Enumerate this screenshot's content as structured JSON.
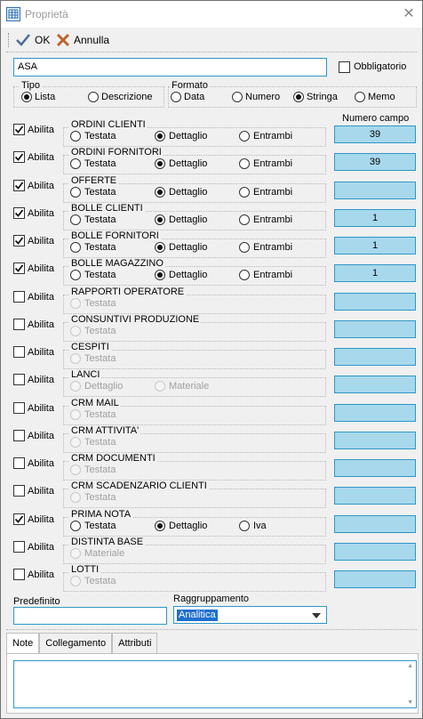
{
  "window": {
    "title": "Proprietà",
    "close_symbol": "✕"
  },
  "toolbar": {
    "ok_label": "OK",
    "cancel_label": "Annulla"
  },
  "name_field": {
    "value": "ASA"
  },
  "obbligatorio": {
    "label": "Obbligatorio",
    "checked": false
  },
  "tipo": {
    "title": "Tipo",
    "options": [
      "Lista",
      "Descrizione"
    ],
    "selected": "Lista"
  },
  "formato": {
    "title": "Formato",
    "options": [
      "Data",
      "Numero",
      "Stringa",
      "Memo"
    ],
    "selected": "Stringa"
  },
  "numero_campo_header": "Numero campo",
  "rows": [
    {
      "abilita": "Abilita",
      "checked": true,
      "title": "ORDINI CLIENTI",
      "options": [
        "Testata",
        "Dettaglio",
        "Entrambi"
      ],
      "selected": "Dettaglio",
      "enabled": true,
      "numero": "39"
    },
    {
      "abilita": "Abilita",
      "checked": true,
      "title": "ORDINI FORNITORI",
      "options": [
        "Testata",
        "Dettaglio",
        "Entrambi"
      ],
      "selected": "Dettaglio",
      "enabled": true,
      "numero": "39"
    },
    {
      "abilita": "Abilita",
      "checked": true,
      "title": "OFFERTE",
      "options": [
        "Testata",
        "Dettaglio",
        "Entrambi"
      ],
      "selected": "Dettaglio",
      "enabled": true,
      "numero": ""
    },
    {
      "abilita": "Abilita",
      "checked": true,
      "title": "BOLLE CLIENTI",
      "options": [
        "Testata",
        "Dettaglio",
        "Entrambi"
      ],
      "selected": "Dettaglio",
      "enabled": true,
      "numero": "1"
    },
    {
      "abilita": "Abilita",
      "checked": true,
      "title": "BOLLE FORNITORI",
      "options": [
        "Testata",
        "Dettaglio",
        "Entrambi"
      ],
      "selected": "Dettaglio",
      "enabled": true,
      "numero": "1"
    },
    {
      "abilita": "Abilita",
      "checked": true,
      "title": "BOLLE MAGAZZINO",
      "options": [
        "Testata",
        "Dettaglio",
        "Entrambi"
      ],
      "selected": "Dettaglio",
      "enabled": true,
      "numero": "1"
    },
    {
      "abilita": "Abilita",
      "checked": false,
      "title": "RAPPORTI OPERATORE",
      "options": [
        "Testata"
      ],
      "selected": "",
      "enabled": false,
      "numero": ""
    },
    {
      "abilita": "Abilita",
      "checked": false,
      "title": "CONSUNTIVI PRODUZIONE",
      "options": [
        "Testata"
      ],
      "selected": "",
      "enabled": false,
      "numero": ""
    },
    {
      "abilita": "Abilita",
      "checked": false,
      "title": "CESPITI",
      "options": [
        "Testata"
      ],
      "selected": "",
      "enabled": false,
      "numero": ""
    },
    {
      "abilita": "Abilita",
      "checked": false,
      "title": "LANCI",
      "options": [
        "Dettaglio",
        "Materiale"
      ],
      "selected": "",
      "enabled": false,
      "numero": ""
    },
    {
      "abilita": "Abilita",
      "checked": false,
      "title": "CRM MAIL",
      "options": [
        "Testata"
      ],
      "selected": "",
      "enabled": false,
      "numero": ""
    },
    {
      "abilita": "Abilita",
      "checked": false,
      "title": "CRM ATTIVITA'",
      "options": [
        "Testata"
      ],
      "selected": "",
      "enabled": false,
      "numero": ""
    },
    {
      "abilita": "Abilita",
      "checked": false,
      "title": "CRM DOCUMENTI",
      "options": [
        "Testata"
      ],
      "selected": "",
      "enabled": false,
      "numero": ""
    },
    {
      "abilita": "Abilita",
      "checked": false,
      "title": "CRM SCADENZARIO CLIENTI",
      "options": [
        "Testata"
      ],
      "selected": "",
      "enabled": false,
      "numero": ""
    },
    {
      "abilita": "Abilita",
      "checked": true,
      "title": "PRIMA NOTA",
      "options": [
        "Testata",
        "Dettaglio",
        "Iva"
      ],
      "selected": "Dettaglio",
      "enabled": true,
      "numero": ""
    },
    {
      "abilita": "Abilita",
      "checked": false,
      "title": "DISTINTA BASE",
      "options": [
        "Materiale"
      ],
      "selected": "",
      "enabled": false,
      "numero": ""
    },
    {
      "abilita": "Abilita",
      "checked": false,
      "title": "LOTTI",
      "options": [
        "Testata"
      ],
      "selected": "",
      "enabled": false,
      "numero": ""
    }
  ],
  "predefinito": {
    "label": "Predefinito",
    "value": ""
  },
  "raggruppamento": {
    "label": "Raggruppamento",
    "value": "Analitica"
  },
  "tabs": [
    {
      "label": "Note",
      "active": true
    },
    {
      "label": "Collegamento",
      "active": false
    },
    {
      "label": "Attributi",
      "active": false
    }
  ],
  "colors": {
    "accent_border": "#2f97c6",
    "numfield_bg": "#a8d8ec",
    "selection": "#1e6fd0"
  }
}
